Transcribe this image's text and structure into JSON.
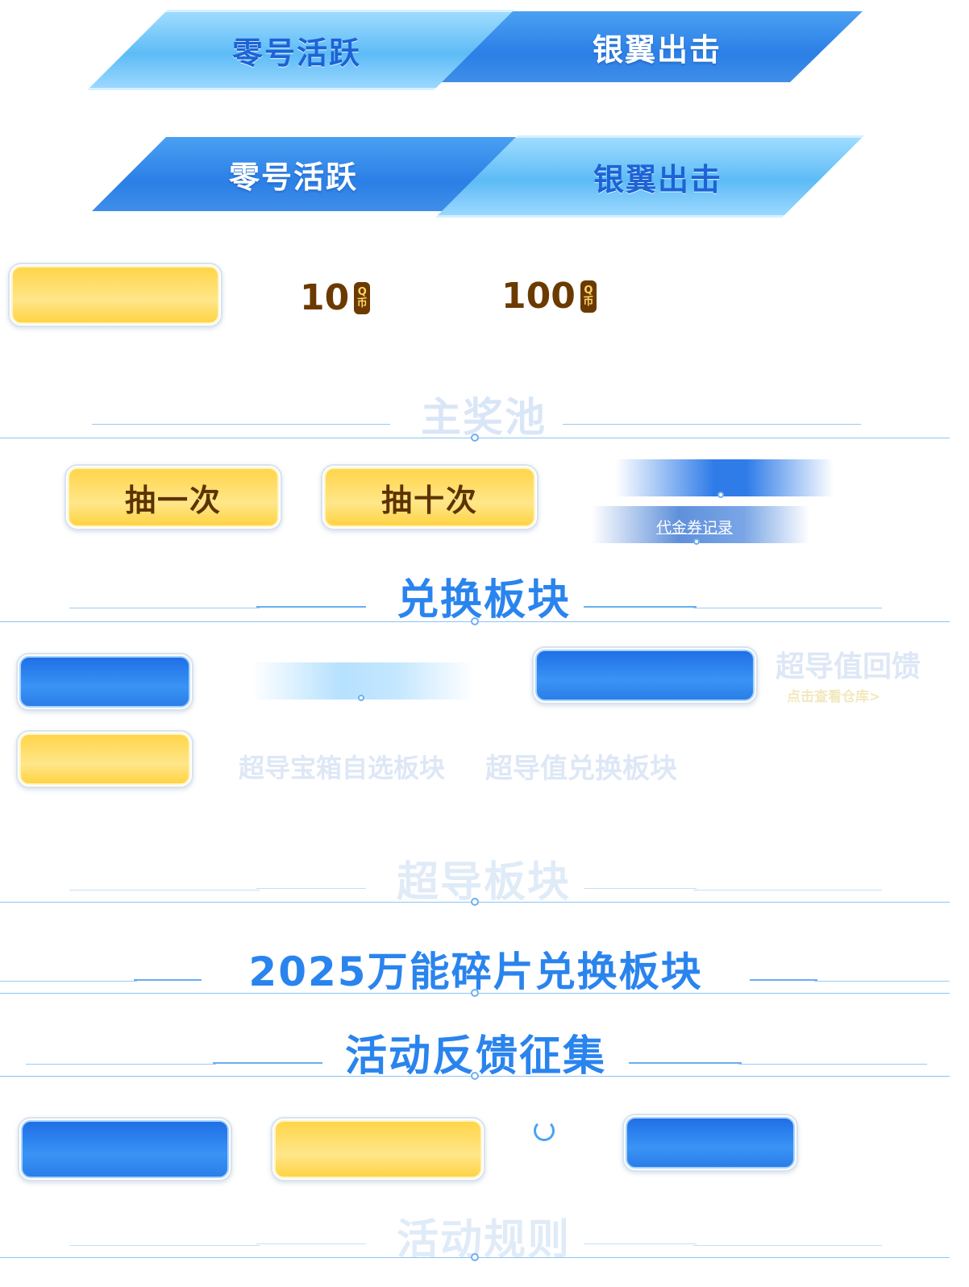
{
  "tabs_row1": {
    "left_label": "零号活跃",
    "right_label": "银翼出击"
  },
  "tabs_row2": {
    "left_label": "零号活跃",
    "right_label": "银翼出击"
  },
  "prices": {
    "price1": "10",
    "price2": "100",
    "currency_top": "Q",
    "currency_bottom": "币"
  },
  "main_pool": {
    "title": "主奖池"
  },
  "draw_buttons": {
    "draw_once": "抽一次",
    "draw_ten": "抽十次"
  },
  "voucher": {
    "record_link": "代金券记录"
  },
  "exchange": {
    "title": "兑换板块"
  },
  "super_value": {
    "title": "超导值回馈",
    "warehouse_link": "点击查看仓库>"
  },
  "ghost_labels": {
    "chest": "超导宝箱自选板块",
    "value_exchange": "超导值兑换板块"
  },
  "superconductor": {
    "title": "超导板块"
  },
  "fragments": {
    "title": "2025万能碎片兑换板块"
  },
  "feedback": {
    "title": "活动反馈征集"
  },
  "rules": {
    "title": "活动规则"
  },
  "colors": {
    "accent_blue": "#2a84ee",
    "button_yellow": "#ffd54a",
    "button_blue": "#1f6fe6",
    "coin_brown": "#6b3a00"
  }
}
